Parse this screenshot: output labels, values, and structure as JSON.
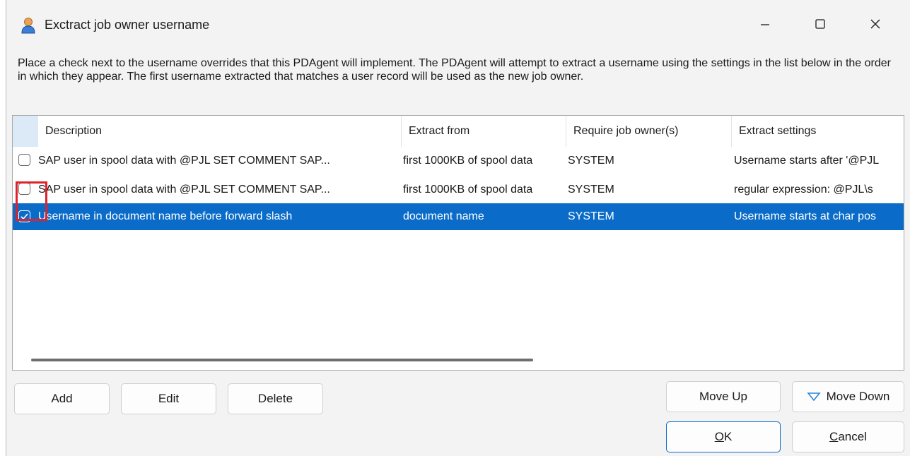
{
  "window": {
    "title": "Exctract job owner username"
  },
  "instructions": "Place a check next to the username overrides that this PDAgent will implement. The PDAgent will attempt to extract a username using the settings in the list below in the order in which they appear. The first username extracted that matches a user record will be used as the new job owner.",
  "list": {
    "columns": [
      "Description",
      "Extract from",
      "Require job owner(s)",
      "Extract settings"
    ],
    "rows": [
      {
        "checked": false,
        "description": "SAP user in spool data with @PJL SET COMMENT SAP...",
        "extract_from": "first 1000KB of spool data",
        "require_owner": "SYSTEM",
        "settings": "Username starts after '@PJL"
      },
      {
        "checked": false,
        "description": "SAP user in spool data with @PJL SET COMMENT SAP...",
        "extract_from": "first 1000KB of spool data",
        "require_owner": "SYSTEM",
        "settings": "regular expression: @PJL\\s"
      },
      {
        "checked": true,
        "description": "Username in document name before forward slash",
        "extract_from": "document name",
        "require_owner": "SYSTEM",
        "settings": "Username starts at char pos"
      }
    ]
  },
  "buttons": {
    "add": "Add",
    "edit": "Edit",
    "delete": "Delete",
    "move_up": "Move Up",
    "move_down": "Move Down",
    "ok_mnemonic": "O",
    "ok_rest": "K",
    "cancel_mnemonic": "C",
    "cancel_rest": "ancel"
  },
  "colors": {
    "selection": "#0a6cc8",
    "highlight": "#e0202a"
  }
}
